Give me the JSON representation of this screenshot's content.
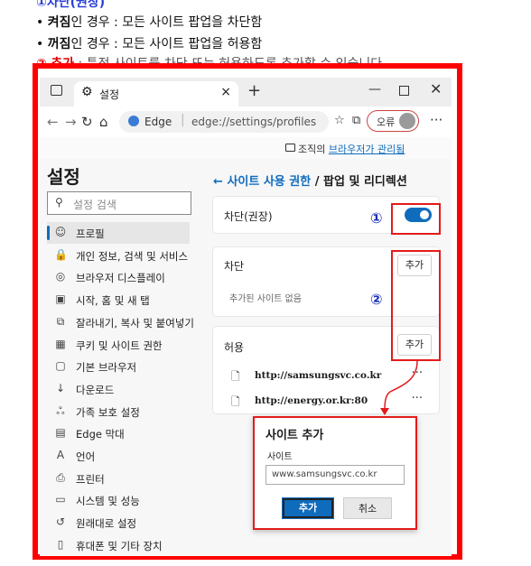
{
  "doc": {
    "heading_num": "①",
    "heading_text": "차단(권장)",
    "line1_bold": "켜짐",
    "line1_rest": "인 경우 : 모든 사이트 팝업을 차단함",
    "line2_bold": "꺼짐",
    "line2_rest": "인 경우 : 모든 사이트 팝업을 허용함",
    "line3_num": "②",
    "line3_label": "추가",
    "line3_rest": ": 특정 사이트를 차단 또는 허용하도록 추가할 수 있습니다."
  },
  "browser": {
    "tab_title": "설정",
    "tab_close": "×",
    "new_tab": "+",
    "address_brand": "Edge",
    "address_sep": "|",
    "address_url": "edge://settings/profiles",
    "error_label": "오류",
    "more": "···",
    "managed_prefix": "조직의 ",
    "managed_link": "브라우저가 관리됨"
  },
  "sidebar": {
    "title": "설정",
    "search_placeholder": "설정 검색",
    "items": [
      {
        "label": "프로필",
        "icon": "☺"
      },
      {
        "label": "개인 정보, 검색 및 서비스",
        "icon": "🔒"
      },
      {
        "label": "브라우저 디스플레이",
        "icon": "◎"
      },
      {
        "label": "시작, 홈 및 새 탭",
        "icon": "▣"
      },
      {
        "label": "잘라내기, 복사 및 붙여넣기",
        "icon": "⧉"
      },
      {
        "label": "쿠키 및 사이트 권한",
        "icon": "▦"
      },
      {
        "label": "기본 브라우저",
        "icon": "▢"
      },
      {
        "label": "다운로드",
        "icon": "↓"
      },
      {
        "label": "가족 보호 설정",
        "icon": "ஃ"
      },
      {
        "label": "Edge 막대",
        "icon": "▤"
      },
      {
        "label": "언어",
        "icon": "A"
      },
      {
        "label": "프린터",
        "icon": "⎙"
      },
      {
        "label": "시스템 및 성능",
        "icon": "▭"
      },
      {
        "label": "원래대로 설정",
        "icon": "↺"
      },
      {
        "label": "휴대폰 및 기타 장치",
        "icon": "▯"
      }
    ]
  },
  "main": {
    "back_arrow": "←",
    "crumb_link": "사이트 사용 권한",
    "crumb_sep": "/",
    "crumb_current": "팝업 및 리디렉션",
    "block_label": "차단(권장)",
    "block_toggle_on": true,
    "block_section": "차단",
    "add_label": "추가",
    "empty_text": "추가된 사이트 없음",
    "allow_section": "허용",
    "allowed_sites": [
      {
        "url": "http://samsungsvc.co.kr",
        "more": "···"
      },
      {
        "url": "http://energy.or.kr:80",
        "more": "···"
      }
    ]
  },
  "annotations": {
    "badge1": "①",
    "badge2": "②"
  },
  "dialog": {
    "title": "사이트 추가",
    "field_label": "사이트",
    "field_value": "www.samsungsvc.co.kr",
    "add_button": "추가",
    "cancel_button": "취소"
  },
  "colors": {
    "accent": "#0f6cbd",
    "annotation_red": "#e31b1b",
    "frame_red": "#ff0000",
    "badge_blue": "#1a2fb8"
  }
}
